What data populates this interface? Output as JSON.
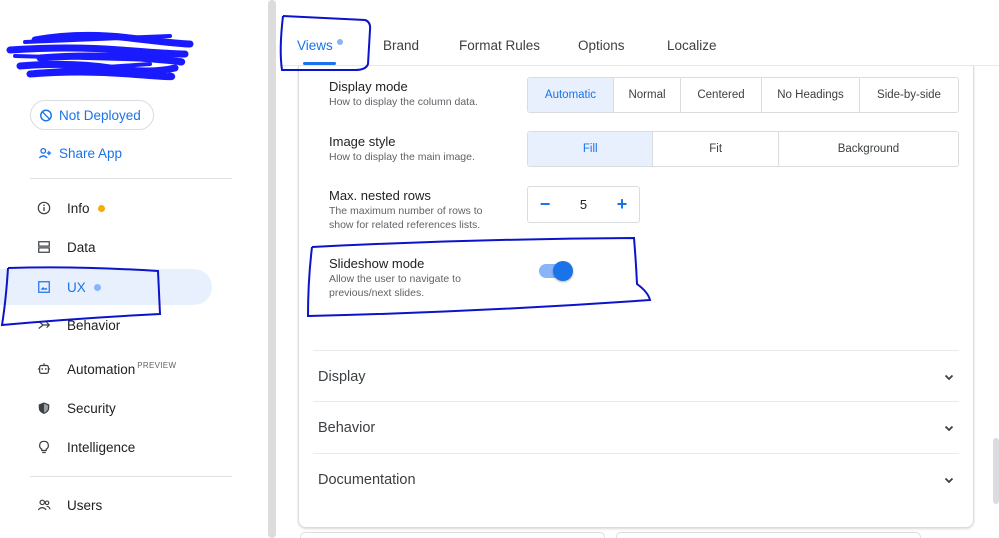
{
  "sidebar": {
    "deploy_label": "Not Deployed",
    "share_label": "Share App",
    "items": [
      {
        "label": "Info",
        "icon": "info-icon",
        "dot": "orange"
      },
      {
        "label": "Data",
        "icon": "database-icon"
      },
      {
        "label": "UX",
        "icon": "image-icon",
        "dot": "blue",
        "active": true
      },
      {
        "label": "Behavior",
        "icon": "branch-icon"
      },
      {
        "label": "Automation",
        "icon": "robot-icon",
        "tag": "PREVIEW"
      },
      {
        "label": "Security",
        "icon": "shield-icon"
      },
      {
        "label": "Intelligence",
        "icon": "bulb-icon"
      },
      {
        "label": "Users",
        "icon": "users-icon"
      }
    ]
  },
  "tabs": [
    {
      "label": "Views",
      "active": true
    },
    {
      "label": "Brand"
    },
    {
      "label": "Format Rules"
    },
    {
      "label": "Options"
    },
    {
      "label": "Localize"
    }
  ],
  "settings": {
    "display_mode": {
      "label": "Display mode",
      "desc": "How to display the column data.",
      "options": [
        "Automatic",
        "Normal",
        "Centered",
        "No Headings",
        "Side-by-side"
      ],
      "selected": "Automatic"
    },
    "image_style": {
      "label": "Image style",
      "desc": "How to display the main image.",
      "options": [
        "Fill",
        "Fit",
        "Background"
      ],
      "selected": "Fill"
    },
    "nested_rows": {
      "label": "Max. nested rows",
      "desc_line1": "The maximum number of rows to",
      "desc_line2": "show for related references lists.",
      "value": "5",
      "minus": "−",
      "plus": "+"
    },
    "slideshow": {
      "label": "Slideshow mode",
      "desc_line1": "Allow the user to navigate to",
      "desc_line2": "previous/next slides.",
      "enabled": true
    }
  },
  "sections": [
    "Display",
    "Behavior",
    "Documentation"
  ],
  "colors": {
    "accent": "#1a73e8",
    "accent_light": "#e8f0fe",
    "annotation": "#0a14c8",
    "redaction": "#1a1aff",
    "info_dot": "#f9ab00"
  }
}
